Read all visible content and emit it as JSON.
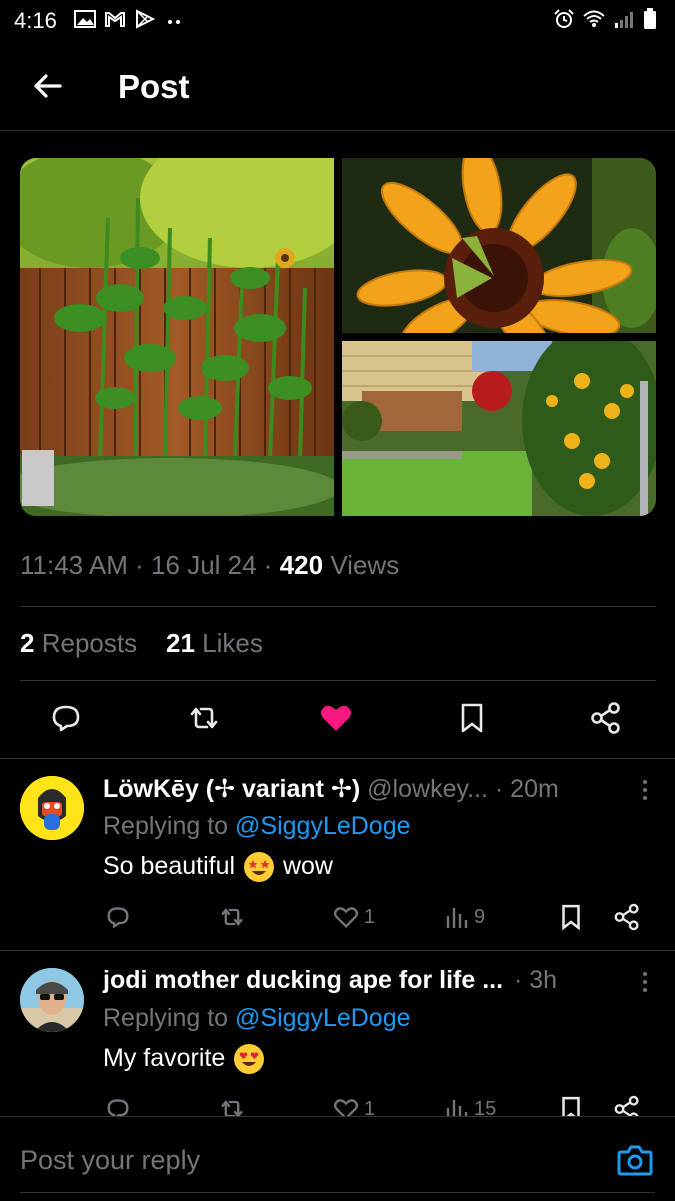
{
  "status_bar": {
    "time": "4:16"
  },
  "header": {
    "title": "Post"
  },
  "post": {
    "time": "11:43 AM",
    "date": "16 Jul 24",
    "views_count": "420",
    "views_label": "Views",
    "reposts_count": "2",
    "reposts_label": "Reposts",
    "likes_count": "21",
    "likes_label": "Likes",
    "liked": true,
    "colors": {
      "like": "#f91880",
      "link": "#1d9bf0",
      "muted": "#71767b"
    }
  },
  "replies": [
    {
      "name": "LöwKēy (✢ variant ✢)",
      "handle": "@lowkey...",
      "time": "· 20m",
      "replying_prefix": "Replying to",
      "replying_handle": "@SiggyLeDoge",
      "text_before": "So beautiful",
      "text_after": "wow",
      "likes": "1",
      "views": "9"
    },
    {
      "name": "jodi mother ducking ape for life ...",
      "handle": "",
      "time": "· 3h",
      "replying_prefix": "Replying to",
      "replying_handle": "@SiggyLeDoge",
      "text_before": "My favorite",
      "text_after": "",
      "likes": "1",
      "views": "15"
    }
  ],
  "composer": {
    "placeholder": "Post your reply"
  }
}
